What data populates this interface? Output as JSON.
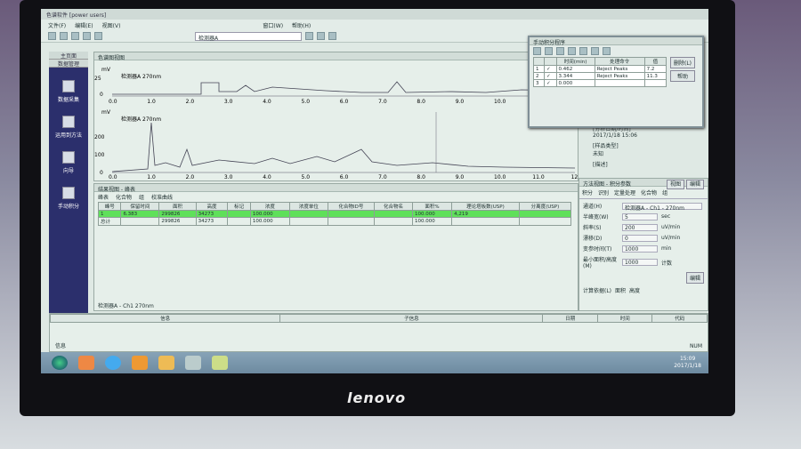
{
  "window": {
    "title": "色谱软件 [power users]"
  },
  "menu": [
    "文件(F)",
    "编辑(E)",
    "视图(V)",
    "窗口(W)",
    "帮助(H)"
  ],
  "toolbar": {
    "detector_select": "检测器A"
  },
  "sidebar": {
    "header_tabs": [
      "主页面",
      "数据管理"
    ],
    "items": [
      {
        "label": "数据采集",
        "icon": "data-acquisition-icon"
      },
      {
        "label": "运用到方法",
        "icon": "method-icon"
      },
      {
        "label": "向导",
        "icon": "wizard-icon"
      },
      {
        "label": "手动积分",
        "icon": "manual-integration-icon"
      }
    ]
  },
  "chromatogram": {
    "title": "色谱图视图",
    "top_trace_label": "检测器A 270nm",
    "bottom_trace_label": "检测器A 270nm",
    "y_unit": "mV",
    "top_y_ticks": [
      "25",
      "0"
    ],
    "bottom_y_ticks": [
      "200",
      "100",
      "0"
    ],
    "x_ticks": [
      "0.0",
      "1.0",
      "2.0",
      "3.0",
      "4.0",
      "5.0",
      "6.0",
      "7.0",
      "8.0",
      "9.0",
      "10.0",
      "11.0",
      "12.0"
    ],
    "x_unit": "min"
  },
  "results": {
    "title": "结果视图 - 峰表",
    "tabs": [
      "峰表",
      "化合物",
      "组",
      "校准曲线"
    ],
    "columns": [
      "峰号",
      "保留时间",
      "面积",
      "高度",
      "标记",
      "浓度",
      "浓度单位",
      "化合物ID号",
      "化合物名",
      "面积%",
      "理论塔板数(USP)",
      "分离度(USP)"
    ],
    "rows": [
      [
        "1",
        "6.383",
        "299826",
        "34273",
        "",
        "100.000",
        "",
        "",
        "",
        "100.000",
        "4,219",
        ""
      ],
      [
        "总计",
        "",
        "299826",
        "34273",
        "",
        "100.000",
        "",
        "",
        "",
        "100.000",
        "",
        ""
      ]
    ],
    "sheet_tab": "检测器A - Ch1 270nm"
  },
  "dialog": {
    "title": "手动积分程序",
    "columns": [
      "",
      "",
      "时间(min)",
      "处理命令",
      "值"
    ],
    "rows": [
      [
        "1",
        "✓",
        "0.462",
        "Reject Peaks",
        "7.2"
      ],
      [
        "2",
        "✓",
        "3.344",
        "Reject Peaks",
        "11.3"
      ],
      [
        "3",
        "✓",
        "0.000",
        "",
        ""
      ]
    ],
    "buttons": [
      "删除(L)",
      "帮助"
    ]
  },
  "info_side": {
    "lines": [
      "[分析日期/时间]",
      "2017/1/18 15:06",
      "[样品类型]",
      "未知",
      "[描述]"
    ]
  },
  "method": {
    "title": "方法视图 - 积分参数",
    "view_button": "视图",
    "edit_button": "编辑",
    "tabs": [
      "积分",
      "识别",
      "定量处理",
      "化合物",
      "组"
    ],
    "channel_label": "通道(H)",
    "channel_value": "检测器A - Ch1 - 270nm",
    "fields": [
      {
        "label": "半峰宽(W)",
        "value": "5",
        "unit": "sec"
      },
      {
        "label": "斜率(S)",
        "value": "200",
        "unit": "uV/min"
      },
      {
        "label": "漂移(D)",
        "value": "0",
        "unit": "uV/min"
      },
      {
        "label": "变参时间(T)",
        "value": "1000",
        "unit": "min"
      },
      {
        "label": "最小面积/高度(M)",
        "value": "1000",
        "unit": "计数"
      }
    ],
    "edit_program": "编辑",
    "quant_label": "计算依据(L)",
    "radio_area": "面积",
    "radio_height": "高度"
  },
  "messages": {
    "columns": [
      "信息",
      "子信息",
      "日期",
      "时间",
      "代码"
    ],
    "tab": "信息",
    "status": "NUM"
  },
  "taskbar": {
    "time": "15:09",
    "date": "2017/1/18"
  },
  "monitor": {
    "brand": "lenovo"
  }
}
